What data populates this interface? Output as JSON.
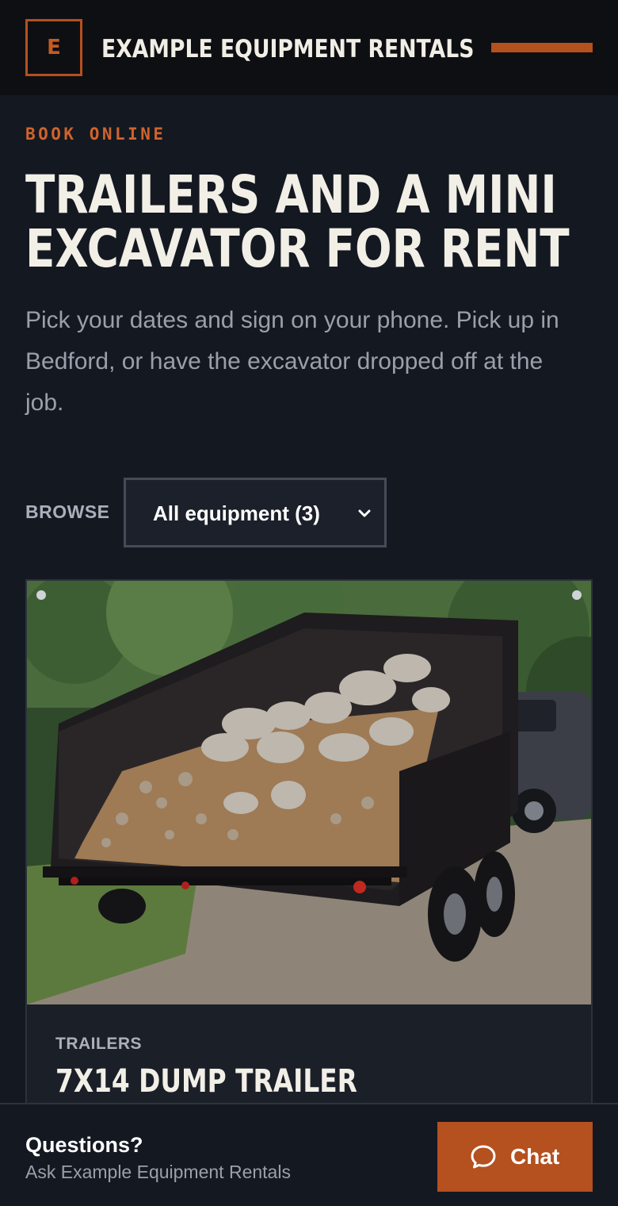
{
  "header": {
    "logo_letter": "E",
    "brand": "EXAMPLE EQUIPMENT RENTALS",
    "menu_icon": "menu-bar-icon"
  },
  "hero": {
    "eyebrow": "BOOK ONLINE",
    "title": "TRAILERS AND A MINI EXCAVATOR FOR RENT",
    "subtitle": "Pick your dates and sign on your phone. Pick up in Bedford, or have the excavator dropped off at the job."
  },
  "browse": {
    "label": "BROWSE",
    "selected": "All equipment (3)",
    "chevron_icon": "chevron-down-icon"
  },
  "listing": {
    "image_alt_icon": "dump-trailer-photo",
    "category": "TRAILERS",
    "title": "7X14 DUMP TRAILER"
  },
  "footer": {
    "question": "Questions?",
    "subtext": "Ask Example Equipment Rentals",
    "chat_label": "Chat",
    "chat_icon": "chat-bubble-icon"
  },
  "colors": {
    "accent": "#b5501f",
    "background": "#141821",
    "header_bg": "#0e0f12",
    "text_light": "#f2efe7",
    "text_muted": "#9aa0ab"
  }
}
